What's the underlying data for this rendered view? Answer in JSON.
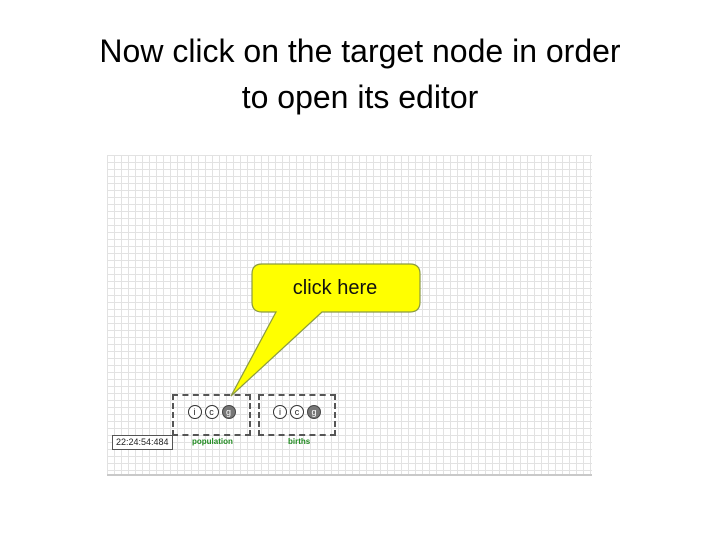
{
  "slide": {
    "title_line1": "Now click on the target node in order",
    "title_line2": "to open its editor"
  },
  "canvas": {
    "timestamp": "22:24:54:484",
    "nodes": [
      {
        "label": "population",
        "icons": [
          "i",
          "c",
          "g"
        ]
      },
      {
        "label": "births",
        "icons": [
          "i",
          "c",
          "g"
        ]
      }
    ]
  },
  "callout": {
    "text": "click here",
    "fill_color": "#ffff00"
  },
  "colors": {
    "node_label": "#208a20",
    "grid_line": "#e2e2e2"
  },
  "icons": {
    "info": "info-icon",
    "connect": "connect-icon",
    "graph": "graph-icon"
  }
}
